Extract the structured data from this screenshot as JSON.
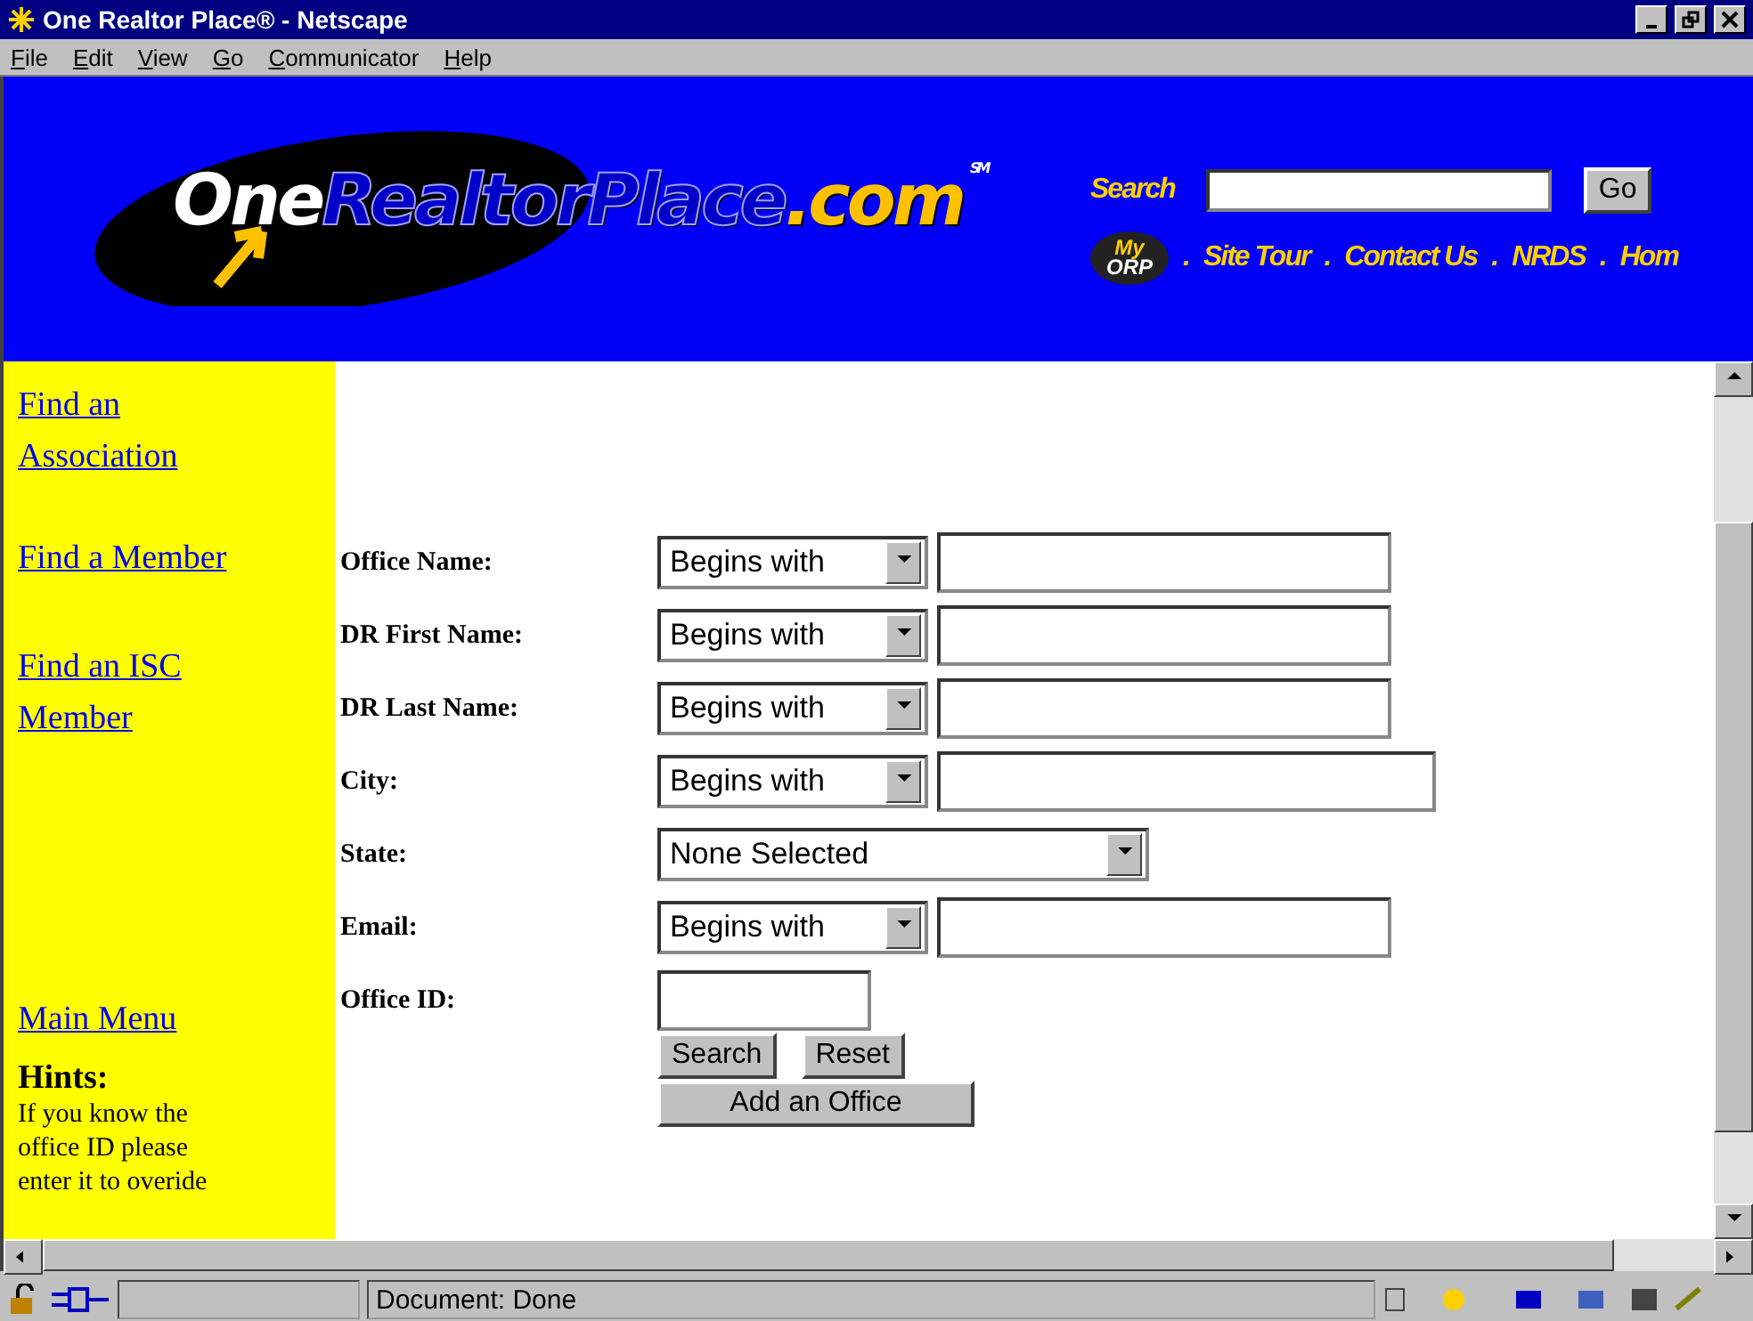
{
  "window": {
    "title": "One Realtor Place® - Netscape"
  },
  "menu": [
    {
      "label": "File"
    },
    {
      "label": "Edit"
    },
    {
      "label": "View"
    },
    {
      "label": "Go"
    },
    {
      "label": "Communicator"
    },
    {
      "label": "Help"
    }
  ],
  "banner": {
    "logo": {
      "parts": [
        "One",
        "RealtorPlace",
        ".com"
      ],
      "mark": "SM"
    },
    "search_label": "Search",
    "search_button": "Go",
    "my_orp": {
      "top": "My",
      "bottom": "ORP"
    },
    "separator": ".",
    "links": [
      "Site Tour",
      "Contact Us",
      "NRDS",
      "Hom"
    ]
  },
  "sidebar": {
    "links": [
      {
        "label": "Find an Association"
      },
      {
        "label": "Find a Member"
      },
      {
        "label": "Find an ISC Member"
      },
      {
        "label": "Main Menu"
      }
    ],
    "hints_title": "Hints:",
    "hints_lines": [
      "If you know the",
      "office ID please",
      "enter it to overide"
    ]
  },
  "form": {
    "rows": [
      {
        "kind": "match",
        "label": "Office Name:",
        "select": "Begins with",
        "wide": false
      },
      {
        "kind": "match",
        "label": "DR First Name:",
        "select": "Begins with",
        "wide": false
      },
      {
        "kind": "match",
        "label": "DR Last Name:",
        "select": "Begins with",
        "wide": false
      },
      {
        "kind": "match",
        "label": "City:",
        "select": "Begins with",
        "wide": true
      },
      {
        "kind": "select",
        "label": "State:",
        "select": "None Selected"
      },
      {
        "kind": "match",
        "label": "Email:",
        "select": "Begins with",
        "wide": false
      },
      {
        "kind": "input",
        "label": "Office ID:"
      }
    ],
    "buttons": [
      "Search",
      "Reset"
    ],
    "add_button": "Add an Office"
  },
  "status_bar": {
    "text": "Document: Done"
  }
}
